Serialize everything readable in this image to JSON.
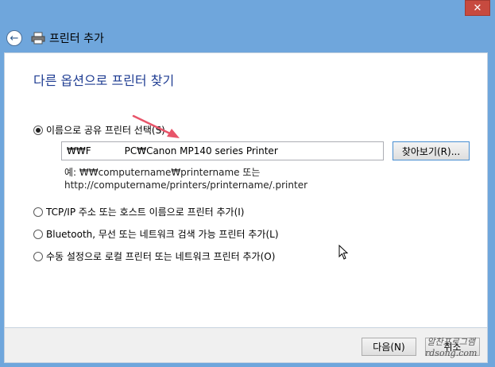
{
  "window": {
    "title": "프린터 추가",
    "close_label": "✕",
    "back_glyph": "←"
  },
  "main": {
    "heading": "다른 옵션으로 프린터 찾기",
    "options": [
      {
        "label": "이름으로 공유 프린터 선택(S)",
        "selected": true
      },
      {
        "label": "TCP/IP 주소 또는 호스트 이름으로 프린터 추가(I)",
        "selected": false
      },
      {
        "label": "Bluetooth, 무선 또는 네트워크 검색 가능 프린터 추가(L)",
        "selected": false
      },
      {
        "label": "수동 설정으로 로컬 프린터 또는 네트워크 프린터 추가(O)",
        "selected": false
      }
    ],
    "share_input_value": "₩₩F           PC₩Canon MP140 series Printer",
    "browse_label": "찾아보기(R)...",
    "example_line1": "예: ₩₩computername₩printername 또는",
    "example_line2": "http://computername/printers/printername/.printer"
  },
  "footer": {
    "next_label": "다음(N)",
    "cancel_label": "취소"
  },
  "watermark": {
    "line1": "알찬프로그램",
    "line2": "rdsong.com"
  },
  "colors": {
    "accent": "#1e3c92",
    "annotation_arrow": "#e8556a"
  },
  "icons": {
    "back": "back-arrow-icon",
    "printer": "printer-icon",
    "close": "close-icon",
    "cursor": "mouse-cursor-icon",
    "annotation": "red-arrow-annotation"
  }
}
